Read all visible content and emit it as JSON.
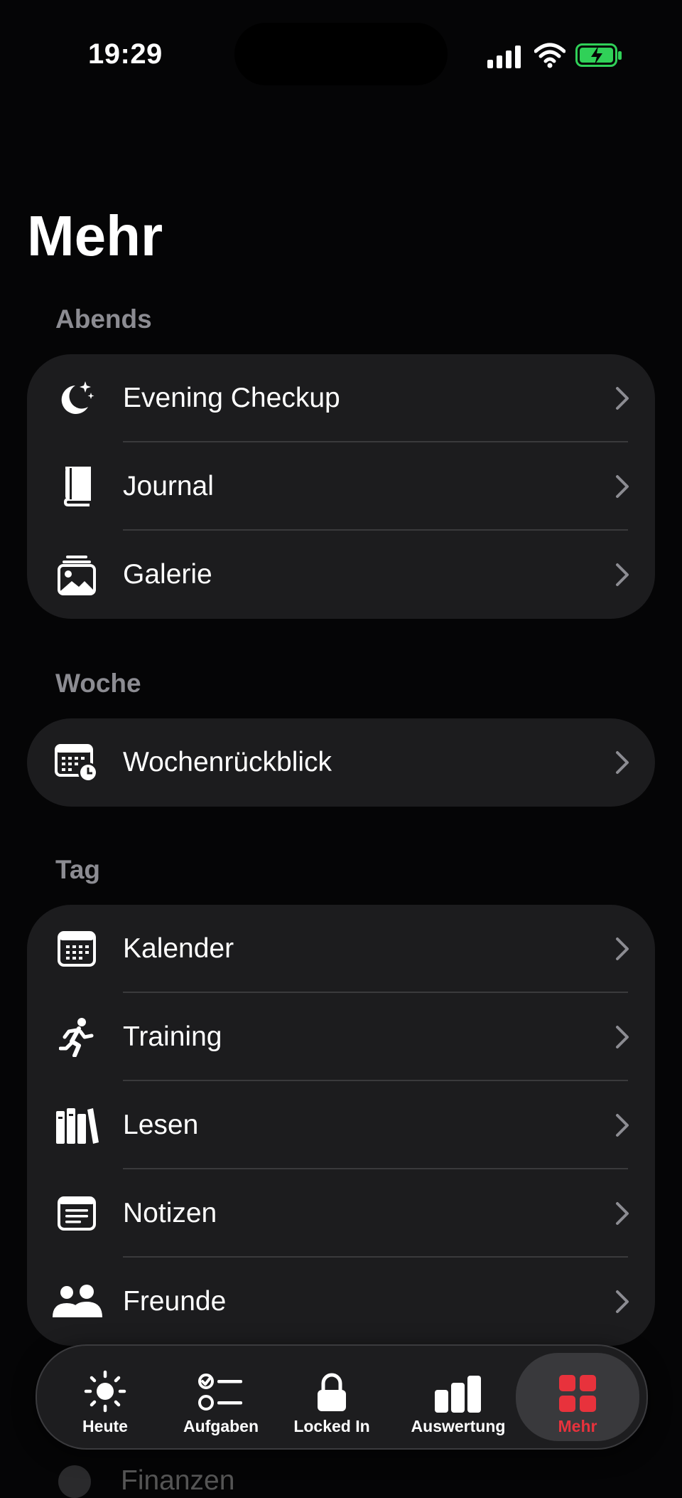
{
  "status_bar": {
    "time": "19:29",
    "battery_color": "#30d158"
  },
  "page": {
    "title": "Mehr"
  },
  "sections": [
    {
      "header": "Abends",
      "items": [
        {
          "label": "Evening Checkup",
          "icon": "moon-stars-icon"
        },
        {
          "label": "Journal",
          "icon": "book-icon"
        },
        {
          "label": "Galerie",
          "icon": "photo-stack-icon"
        }
      ]
    },
    {
      "header": "Woche",
      "items": [
        {
          "label": "Wochenrückblick",
          "icon": "calendar-clock-icon"
        }
      ]
    },
    {
      "header": "Tag",
      "items": [
        {
          "label": "Kalender",
          "icon": "calendar-icon"
        },
        {
          "label": "Training",
          "icon": "runner-icon"
        },
        {
          "label": "Lesen",
          "icon": "books-icon"
        },
        {
          "label": "Notizen",
          "icon": "notes-icon"
        },
        {
          "label": "Freunde",
          "icon": "people-icon"
        }
      ]
    }
  ],
  "partially_hidden_item": {
    "label": "Finanzen"
  },
  "tab_bar": {
    "accent_color": "#e8323c",
    "tabs": [
      {
        "label": "Heute",
        "icon": "sun-icon"
      },
      {
        "label": "Aufgaben",
        "icon": "checklist-icon"
      },
      {
        "label": "Locked In",
        "icon": "lock-icon"
      },
      {
        "label": "Auswertung",
        "icon": "bar-chart-icon"
      },
      {
        "label": "Mehr",
        "icon": "grid-icon",
        "selected": true
      }
    ]
  }
}
